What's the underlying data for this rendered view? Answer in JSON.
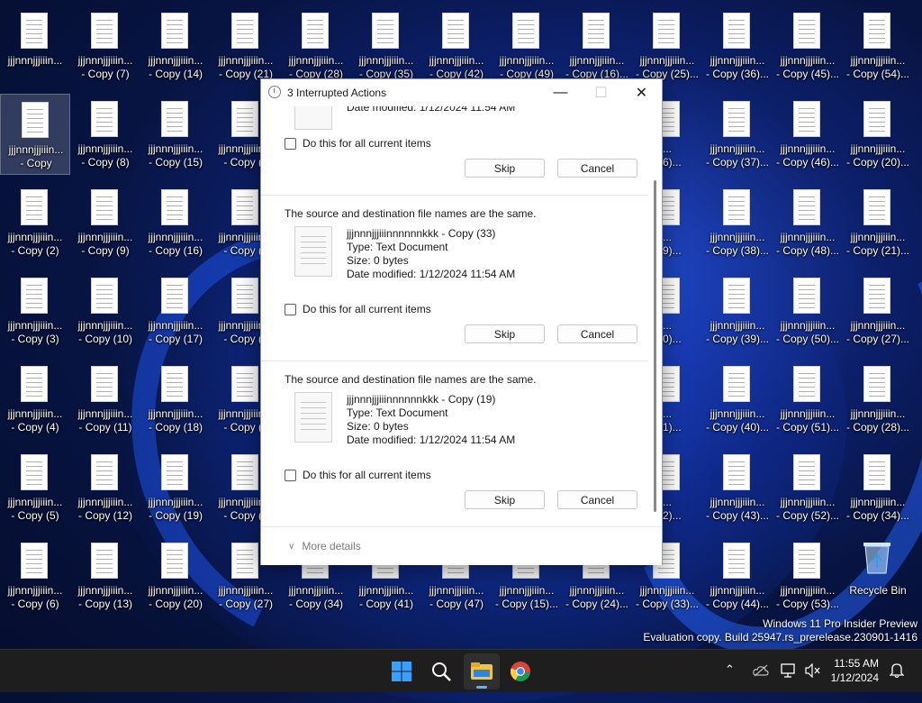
{
  "desktop": {
    "icons": [
      [
        "jjjnnnjjjiiin...",
        "jjjnnnjjjiiin...\n- Copy (7)",
        "jjjnnnjjjiiin...\n- Copy (14)",
        "jjjnnnjjjiiin...\n- Copy (21)",
        "jjjnnnjjjiiin...\n- Copy (28)",
        "jjjnnnjjjiiin...\n- Copy (35)",
        "jjjnnnjjjiiin...\n- Copy (42)",
        "jjjnnnjjjiiin...\n- Copy (49)",
        "jjjnnnjjjiiin...\n- Copy (16)...",
        "jjjnnnjjjiiin...\n- Copy (25)...",
        "jjjnnnjjjiiin...\n- Copy (36)...",
        "jjjnnnjjjiiin...\n- Copy (45)...",
        "jjjnnnjjjiiin...\n- Copy (54)..."
      ],
      [
        "jjjnnnjjjiiin...\n- Copy",
        "jjjnnnjjjiiin...\n- Copy (8)",
        "jjjnnnjjjiiin...\n- Copy (15)",
        "jjjnnnjjjiiin...\n- Copy (2",
        "",
        "",
        "",
        "",
        "",
        "...\n(26)...",
        "jjjnnnjjjiiin...\n- Copy (37)...",
        "jjjnnnjjjiiin...\n- Copy (46)...",
        "jjjnnnjjjiiin...\n- Copy (20)..."
      ],
      [
        "jjjnnnjjjiiin...\n- Copy (2)",
        "jjjnnnjjjiiin...\n- Copy (9)",
        "jjjnnnjjjiiin...\n- Copy (16)",
        "jjjnnnjjjiiin...\n- Copy (2",
        "",
        "",
        "",
        "",
        "",
        "...\n(29)...",
        "jjjnnnjjjiiin...\n- Copy (38)...",
        "jjjnnnjjjiiin...\n- Copy (48)...",
        "jjjnnnjjjiiin...\n- Copy (21)..."
      ],
      [
        "jjjnnnjjjiiin...\n- Copy (3)",
        "jjjnnnjjjiiin...\n- Copy (10)",
        "jjjnnnjjjiiin...\n- Copy (17)",
        "jjjnnnjjjiiin...\n- Copy (2",
        "",
        "",
        "",
        "",
        "",
        "...\n(30)...",
        "jjjnnnjjjiiin...\n- Copy (39)...",
        "jjjnnnjjjiiin...\n- Copy (50)...",
        "jjjnnnjjjiiin...\n- Copy (27)..."
      ],
      [
        "jjjnnnjjjiiin...\n- Copy (4)",
        "jjjnnnjjjiiin...\n- Copy (11)",
        "jjjnnnjjjiiin...\n- Copy (18)",
        "jjjnnnjjjiiin...\n- Copy (2",
        "",
        "",
        "",
        "",
        "",
        "...\n(31)...",
        "jjjnnnjjjiiin...\n- Copy (40)...",
        "jjjnnnjjjiiin...\n- Copy (51)...",
        "jjjnnnjjjiiin...\n- Copy (28)..."
      ],
      [
        "jjjnnnjjjiiin...\n- Copy (5)",
        "jjjnnnjjjiiin...\n- Copy (12)",
        "jjjnnnjjjiiin...\n- Copy (19)",
        "jjjnnnjjjiiin...\n- Copy (2",
        "",
        "",
        "",
        "",
        "",
        "...\n(32)...",
        "jjjnnnjjjiiin...\n- Copy (43)...",
        "jjjnnnjjjiiin...\n- Copy (52)...",
        "jjjnnnjjjiiin...\n- Copy (34)..."
      ],
      [
        "jjjnnnjjjiiin...\n- Copy (6)",
        "jjjnnnjjjiiin...\n- Copy (13)",
        "jjjnnnjjjiiin...\n- Copy (20)",
        "jjjnnnjjjiiin...\n- Copy (27)",
        "jjjnnnjjjiiin...\n- Copy (34)",
        "jjjnnnjjjiiin...\n- Copy (41)",
        "jjjnnnjjjiiin...\n- Copy (47)",
        "jjjnnnjjjiiin...\n- Copy (15)...",
        "jjjnnnjjjiiin...\n- Copy (24)...",
        "jjjnnnjjjiiin...\n- Copy (33)...",
        "jjjnnnjjjiiin...\n- Copy (44)...",
        "jjjnnnjjjiiin...\n- Copy (53)...",
        "Recycle Bin"
      ]
    ],
    "watermark_line1": "Windows 11 Pro Insider Preview",
    "watermark_line2": "Evaluation copy. Build 25947.rs_prerelease.230901-1416"
  },
  "dialog": {
    "title": "3 Interrupted Actions",
    "minimize_label": "—",
    "maximize_label": "☐",
    "close_label": "✕",
    "top_partial": {
      "date_modified": "Date modified: 1/12/2024 11:54 AM",
      "checkbox_label": "Do this for all current items",
      "skip_label": "Skip",
      "cancel_label": "Cancel"
    },
    "items": [
      {
        "message": "The source and destination file names are the same.",
        "file_name": "jjjnnnjjjiiinnnnnnkkk - Copy (33)",
        "type": "Type: Text Document",
        "size": "Size: 0 bytes",
        "date_modified": "Date modified: 1/12/2024 11:54 AM",
        "checkbox_label": "Do this for all current items",
        "skip_label": "Skip",
        "cancel_label": "Cancel"
      },
      {
        "message": "The source and destination file names are the same.",
        "file_name": "jjjnnnjjjiiinnnnnnkkk - Copy (19)",
        "type": "Type: Text Document",
        "size": "Size: 0 bytes",
        "date_modified": "Date modified: 1/12/2024 11:54 AM",
        "checkbox_label": "Do this for all current items",
        "skip_label": "Skip",
        "cancel_label": "Cancel"
      }
    ],
    "more_details": "More details"
  },
  "taskbar": {
    "clock_time": "11:55 AM",
    "clock_date": "1/12/2024",
    "icons": [
      "windows-start-icon",
      "search-icon",
      "file-explorer-icon",
      "chrome-icon"
    ],
    "tray": [
      "chevron-up-icon",
      "onedrive-icon",
      "network-icon",
      "volume-muted-icon",
      "notification-bell-icon"
    ]
  },
  "colors": {
    "accent": "#0067c0",
    "taskbar_bg": "#1e1e1e",
    "dialog_bg": "#ffffff"
  }
}
